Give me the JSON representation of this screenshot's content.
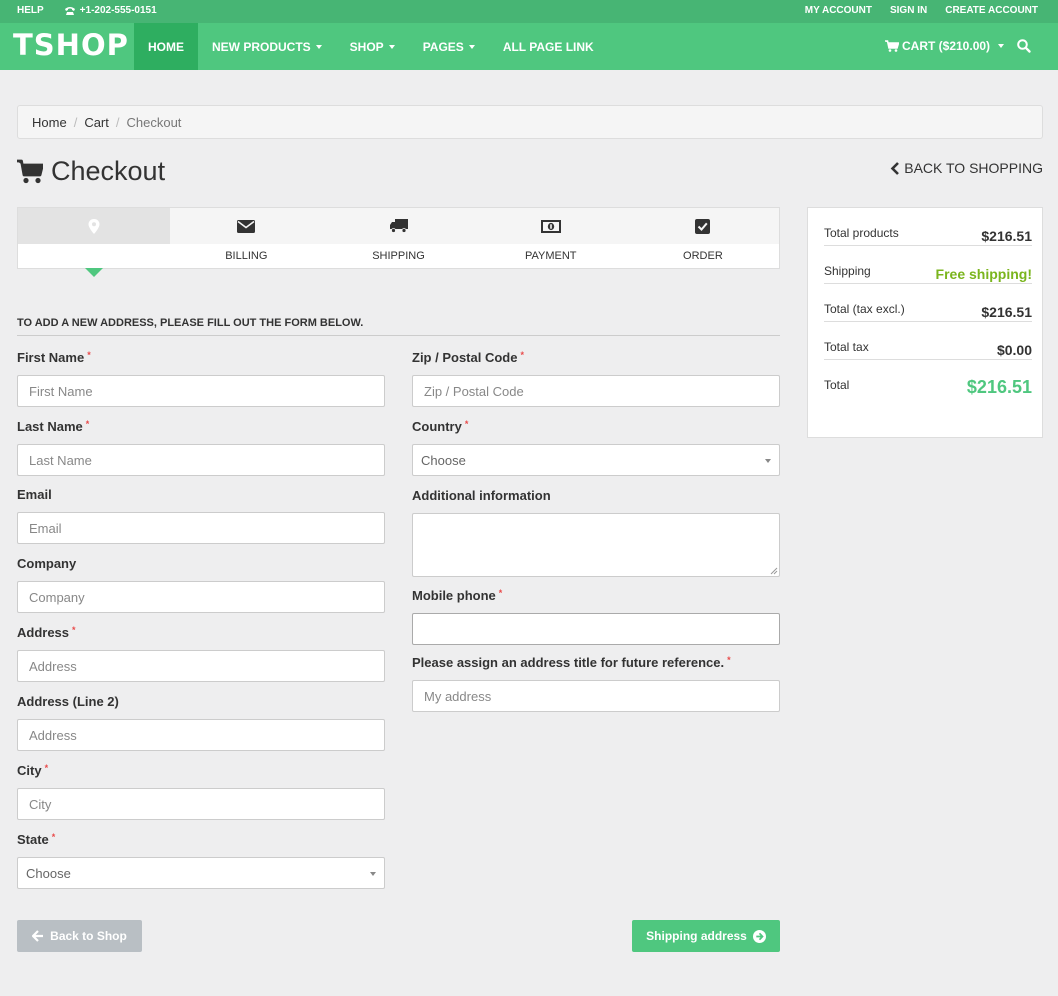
{
  "topbar": {
    "help": "HELP",
    "phone": "+1-202-555-0151",
    "my_account": "MY ACCOUNT",
    "sign_in": "SIGN IN",
    "create_account": "CREATE ACCOUNT"
  },
  "nav": {
    "logo": "TSHOP",
    "items": [
      "HOME",
      "NEW PRODUCTS",
      "SHOP",
      "PAGES",
      "ALL PAGE LINK"
    ],
    "cart": "CART ($210.00)"
  },
  "breadcrumb": [
    "Home",
    "Cart",
    "Checkout"
  ],
  "page": {
    "title": "Checkout",
    "back_link": "BACK TO SHOPPING"
  },
  "steps": {
    "labels": [
      "",
      "BILLING",
      "SHIPPING",
      "PAYMENT",
      "ORDER"
    ],
    "icons": [
      "map-marker-icon",
      "envelope-icon",
      "truck-icon",
      "money-icon",
      "checkbox-icon"
    ],
    "active_index": 0
  },
  "form": {
    "heading": "TO ADD A NEW ADDRESS, PLEASE FILL OUT THE FORM BELOW.",
    "required_mark": "*",
    "left": [
      {
        "label": "First Name",
        "placeholder": "First Name",
        "required": true
      },
      {
        "label": "Last Name",
        "placeholder": "Last Name",
        "required": true
      },
      {
        "label": "Email",
        "placeholder": "Email",
        "required": false
      },
      {
        "label": "Company",
        "placeholder": "Company",
        "required": false
      },
      {
        "label": "Address",
        "placeholder": "Address",
        "required": true
      },
      {
        "label": "Address (Line 2)",
        "placeholder": "Address",
        "required": false
      },
      {
        "label": "City",
        "placeholder": "City",
        "required": true
      },
      {
        "label": "State",
        "value": "Choose",
        "required": true
      }
    ],
    "right": [
      {
        "label": "Zip / Postal Code",
        "placeholder": "Zip / Postal Code",
        "required": true
      },
      {
        "label": "Country",
        "value": "Choose",
        "required": true
      },
      {
        "label": "Additional information",
        "placeholder": "",
        "required": false
      },
      {
        "label": "Mobile phone",
        "placeholder": "",
        "required": true
      },
      {
        "label": "Please assign an address title for future reference.",
        "placeholder": "My address",
        "required": true
      }
    ]
  },
  "summary": {
    "rows": [
      {
        "label": "Total products",
        "value": "$216.51"
      },
      {
        "label": "Shipping",
        "value": "Free shipping!"
      },
      {
        "label": "Total (tax excl.)",
        "value": "$216.51"
      },
      {
        "label": "Total tax",
        "value": "$0.00"
      },
      {
        "label": "Total",
        "value": "$216.51"
      }
    ]
  },
  "buttons": {
    "back": "Back to Shop",
    "next": "Shipping address"
  },
  "colors": {
    "brand_green": "#4fc77f",
    "top_bar": "#47b574",
    "active_nav": "#2eae60",
    "free_shipping": "#7ab51d",
    "required": "#e94b4b"
  }
}
